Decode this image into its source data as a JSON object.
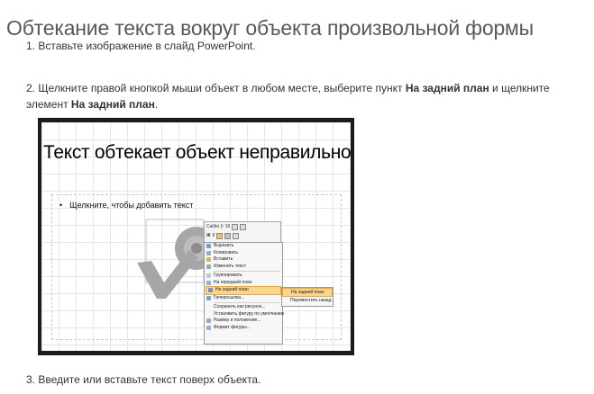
{
  "page": {
    "title": "Обтекание текста вокруг объекта произвольной формы"
  },
  "steps": {
    "s1": "1. Вставьте изображение в слайд PowerPoint.",
    "s2_prefix": "2. Щелкните правой кнопкой мыши объект в любом месте, выберите пункт ",
    "s2_bold1": "На задний план",
    "s2_mid": " и щелкните элемент ",
    "s2_bold2": "На задний план",
    "s2_suffix": ".",
    "s3": "3. Введите или вставьте текст поверх объекта."
  },
  "slide": {
    "title": "Текст обтекает объект неправильной формы",
    "placeholder_text": "Щелкните, чтобы добавить текст",
    "bullet": "•"
  },
  "minibar": {
    "font": "Calibri (t",
    "size": "18",
    "bold": "Ж",
    "italic": "К"
  },
  "context_menu": {
    "items": [
      "Вырезать",
      "Копировать",
      "Вставить",
      "Изменить текст",
      "Группировать",
      "На передний план",
      "На задний план",
      "Гиперссылка...",
      "Сохранить как рисунок...",
      "Установить фигуру по умолчанию",
      "Размер и положение...",
      "Формат фигуры..."
    ],
    "highlighted_index": 6
  },
  "submenu": {
    "items": [
      "На задний план",
      "Переместить назад"
    ],
    "highlighted_index": 0
  },
  "colors": {
    "title_gray": "#595959",
    "menu_highlight": "#fbd58a",
    "shape_gray": "#a6a6a6"
  }
}
